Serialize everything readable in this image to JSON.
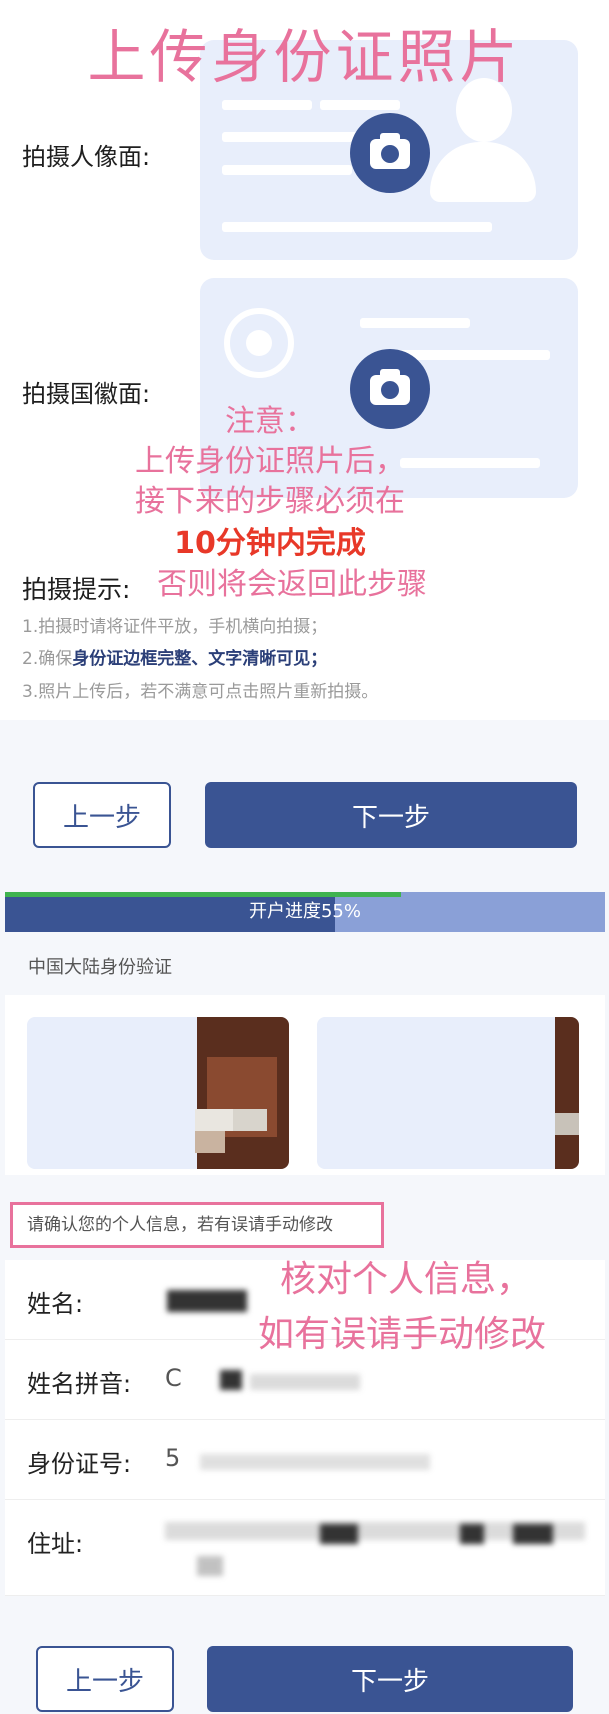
{
  "upload": {
    "title": "上传身份证照片",
    "front_label": "拍摄人像面:",
    "back_label": "拍摄国徽面:",
    "notice_lines": [
      "注意：",
      "上传身份证照片后，",
      "接下来的步骤必须在",
      "10分钟内完成",
      "否则将会返回此步骤"
    ],
    "tip_title": "拍摄提示:",
    "tip1": "1.拍摄时请将证件平放，手机横向拍摄；",
    "tip2_prefix": "2.确保",
    "tip2_bold": "身份证边框完整、文字清晰可见；",
    "tip3": "3.照片上传后，若不满意可点击照片重新拍摄。",
    "prev_label": "上一步",
    "next_label": "下一步",
    "camera_icon": "camera-icon",
    "accent_color": "#3a5493",
    "annotation_color": "#e8729c"
  },
  "verify": {
    "progress_text": "开户进度55%",
    "progress_value": 0.55,
    "section_title": "中国大陆身份验证",
    "confirm_note": "请确认您的个人信息，若有误请手动修改",
    "check_note_lines": [
      "核对个人信息，",
      "如有误请手动修改"
    ],
    "rows": [
      {
        "label": "姓名:",
        "value": ""
      },
      {
        "label": "姓名拼音:",
        "value": "C"
      },
      {
        "label": "身份证号:",
        "value": "5"
      },
      {
        "label": "住址:",
        "value": ""
      }
    ],
    "prev_label": "上一步",
    "next_label": "下一步"
  }
}
